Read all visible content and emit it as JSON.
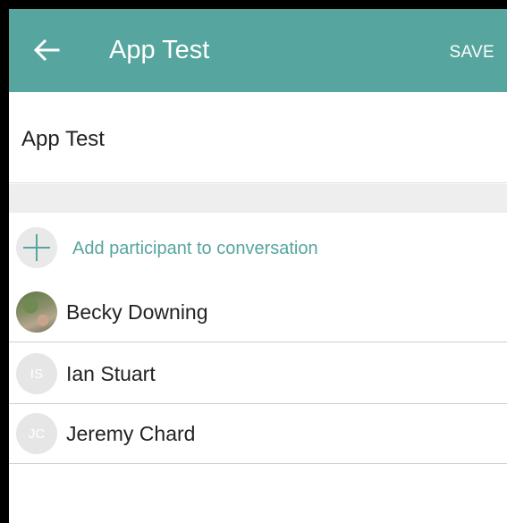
{
  "toolbar": {
    "title": "App Test",
    "save_label": "SAVE",
    "back_icon": "arrow-left-icon"
  },
  "name_field": {
    "value": "App Test"
  },
  "add_participant": {
    "label": "Add participant to conversation",
    "icon": "plus-icon"
  },
  "participants": [
    {
      "name": "Becky Downing",
      "initials": "",
      "avatar": "photo"
    },
    {
      "name": "Ian Stuart",
      "initials": "IS",
      "avatar": "initials"
    },
    {
      "name": "Jeremy Chard",
      "initials": "JC",
      "avatar": "initials"
    }
  ],
  "colors": {
    "accent": "#56a59e",
    "divider": "#cfcfcf",
    "section_gap": "#eeeeee",
    "avatar_bg": "#e6e6e6"
  }
}
